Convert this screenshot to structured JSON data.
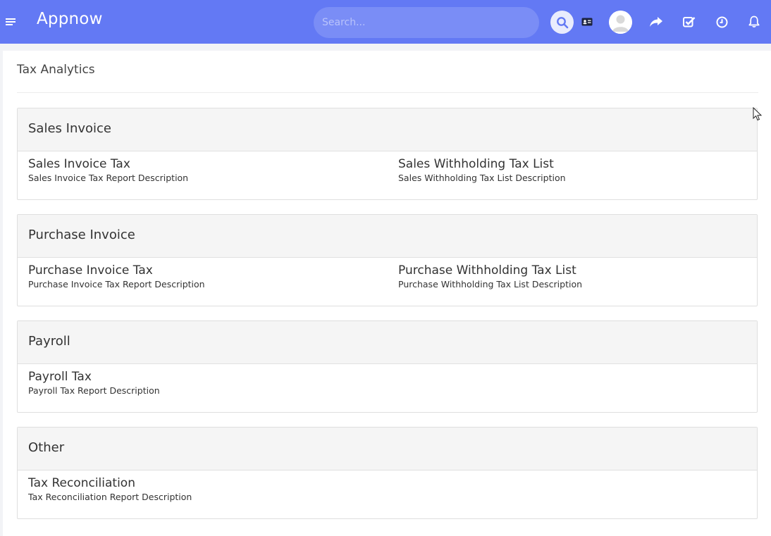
{
  "header": {
    "app_name": "Appnow",
    "search_placeholder": "Search...",
    "accent_color": "#6379f4",
    "icons": [
      "menu-icon",
      "search-icon",
      "id-card-icon",
      "user-avatar",
      "share-icon",
      "tasks-icon",
      "clock-icon",
      "bell-icon"
    ]
  },
  "page": {
    "title": "Tax Analytics"
  },
  "sections": [
    {
      "title": "Sales Invoice",
      "reports": [
        {
          "name": "Sales Invoice Tax",
          "description": "Sales Invoice Tax Report Description"
        },
        {
          "name": "Sales Withholding Tax List",
          "description": "Sales Withholding Tax List Description"
        }
      ]
    },
    {
      "title": "Purchase Invoice",
      "reports": [
        {
          "name": "Purchase Invoice Tax",
          "description": "Purchase Invoice Tax Report Description"
        },
        {
          "name": "Purchase Withholding Tax List",
          "description": "Purchase Withholding Tax List Description"
        }
      ]
    },
    {
      "title": "Payroll",
      "reports": [
        {
          "name": "Payroll Tax",
          "description": "Payroll Tax Report Description"
        }
      ]
    },
    {
      "title": "Other",
      "reports": [
        {
          "name": "Tax Reconciliation",
          "description": "Tax Reconciliation Report Description"
        }
      ]
    }
  ]
}
